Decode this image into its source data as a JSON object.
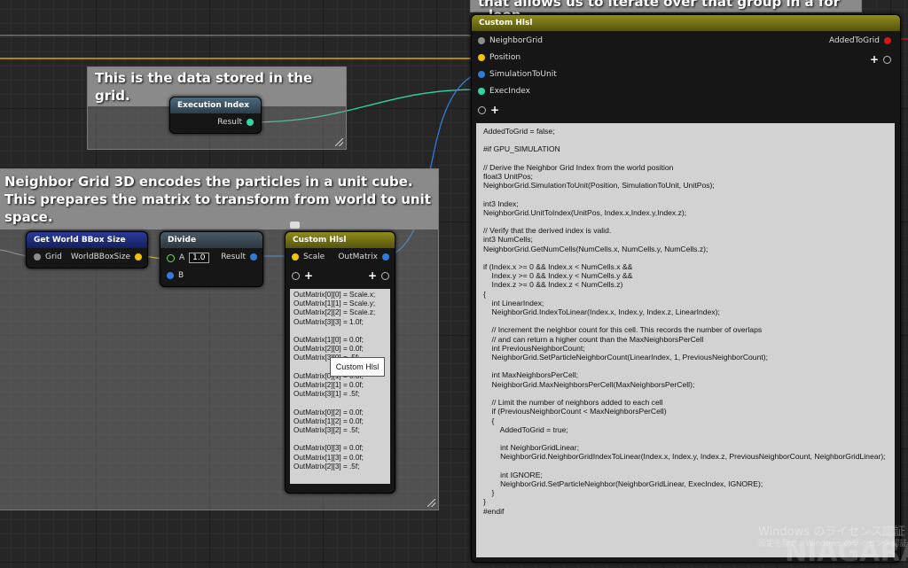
{
  "comments": {
    "top_fragment": "that allows us to iterate over that group in a for",
    "top_fragment2": "loop",
    "grid_data": "This is the data stored in the grid.",
    "neighbor_grid": "Neighbor Grid 3D encodes the particles in a unit cube. This prepares the matrix to transform from world to unit space."
  },
  "exec_index_node": {
    "title": "Execution Index",
    "result": "Result"
  },
  "bbox_node": {
    "title": "Get World BBox Size",
    "grid": "Grid",
    "out": "WorldBBoxSize"
  },
  "divide_node": {
    "title": "Divide",
    "a": "A",
    "a_value": "1.0",
    "result": "Result",
    "b": "B"
  },
  "small_hlsl": {
    "title": "Custom Hlsl",
    "scale": "Scale",
    "out": "OutMatrix",
    "tooltip": "Custom Hlsl",
    "code": "OutMatrix[0][0] = Scale.x;\nOutMatrix[1][1] = Scale.y;\nOutMatrix[2][2] = Scale.z;\nOutMatrix[3][3] = 1.0f;\n\nOutMatrix[1][0] = 0.0f;\nOutMatrix[2][0] = 0.0f;\nOutMatrix[3][0] = .5f;\n\nOutMatrix[0][1] = 0.0f;\nOutMatrix[2][1] = 0.0f;\nOutMatrix[3][1] = .5f;\n\nOutMatrix[0][2] = 0.0f;\nOutMatrix[1][2] = 0.0f;\nOutMatrix[3][2] = .5f;\n\nOutMatrix[0][3] = 0.0f;\nOutMatrix[1][3] = 0.0f;\nOutMatrix[2][3] = .5f;"
  },
  "big_hlsl": {
    "title": "Custom Hlsl",
    "inputs": [
      "NeighborGrid",
      "Position",
      "SimulationToUnit",
      "ExecIndex"
    ],
    "output": "AddedToGrid",
    "code": "AddedToGrid = false;\n\n#if GPU_SIMULATION\n\n// Derive the Neighbor Grid Index from the world position\nfloat3 UnitPos;\nNeighborGrid.SimulationToUnit(Position, SimulationToUnit, UnitPos);\n\nint3 Index;\nNeighborGrid.UnitToIndex(UnitPos, Index.x,Index.y,Index.z);\n\n// Verify that the derived index is valid.\nint3 NumCells;\nNeighborGrid.GetNumCells(NumCells.x, NumCells.y, NumCells.z);\n\nif (Index.x >= 0 && Index.x < NumCells.x &&\n    Index.y >= 0 && Index.y < NumCells.y &&\n    Index.z >= 0 && Index.z < NumCells.z)\n{\n    int LinearIndex;\n    NeighborGrid.IndexToLinear(Index.x, Index.y, Index.z, LinearIndex);\n\n    // Increment the neighbor count for this cell. This records the number of overlaps\n    // and can return a higher count than the MaxNeighborsPerCell\n    int PreviousNeighborCount;\n    NeighborGrid.SetParticleNeighborCount(LinearIndex, 1, PreviousNeighborCount);\n\n    int MaxNeighborsPerCell;\n    NeighborGrid.MaxNeighborsPerCell(MaxNeighborsPerCell);\n\n    // Limit the number of neighbors added to each cell\n    if (PreviousNeighborCount < MaxNeighborsPerCell)\n    {\n        AddedToGrid = true;\n\n        int NeighborGridLinear;\n        NeighborGrid.NeighborGridIndexToLinear(Index.x, Index.y, Index.z, PreviousNeighborCount, NeighborGridLinear);\n\n        int IGNORE;\n        NeighborGrid.SetParticleNeighbor(NeighborGridLinear, ExecIndex, IGNORE);\n    }\n}\n#endif"
  },
  "watermark": {
    "line1": "Windows のライセンス認証",
    "line2": "設定を開き、Windows のライセンス認証",
    "brand": "NIAGARA"
  },
  "colors": {
    "vector": "#f5c400",
    "float": "#74e14a",
    "exec_index": "#2fd6a6",
    "struct": "#2f7bd9",
    "grid": "#8c8c8c",
    "bool": "#d01818"
  }
}
